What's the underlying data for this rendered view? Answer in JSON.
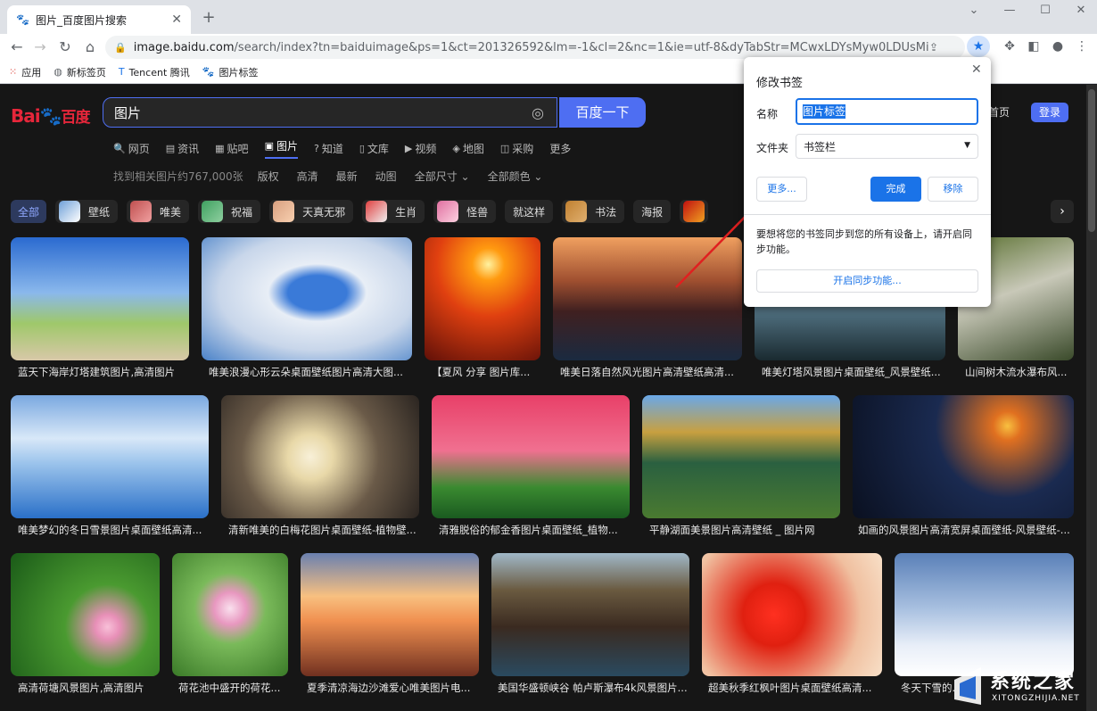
{
  "browser": {
    "tab_title": "图片_百度图片搜索",
    "url_host": "image.baidu.com",
    "url_path": "/search/index?tn=baiduimage&ps=1&ct=201326592&lm=-1&cl=2&nc=1&ie=utf-8&dyTabStr=MCwxLDYsMyw0LDUsMiw3LDgsOQ%3...",
    "bookmarks": [
      "应用",
      "新标签页",
      "Tencent 腾讯",
      "图片标签"
    ]
  },
  "page": {
    "logo_text": "Bai",
    "logo_cn": "百度",
    "search_query": "图片",
    "search_button": "百度一下",
    "nav": [
      "网页",
      "资讯",
      "贴吧",
      "图片",
      "知道",
      "文库",
      "视频",
      "地图",
      "采购",
      "更多"
    ],
    "filters": {
      "count": "找到相关图片约767,000张",
      "items": [
        "版权",
        "高清",
        "最新",
        "动图",
        "全部尺寸 ⌄",
        "全部颜色 ⌄"
      ]
    },
    "header_link": "首页",
    "login": "登录",
    "tags": [
      {
        "label": "全部"
      },
      {
        "label": "壁纸"
      },
      {
        "label": "唯美"
      },
      {
        "label": "祝福"
      },
      {
        "label": "天真无邪"
      },
      {
        "label": "生肖"
      },
      {
        "label": "怪兽"
      },
      {
        "label": "就这样"
      },
      {
        "label": "书法"
      },
      {
        "label": "海报"
      }
    ],
    "captions": [
      "蓝天下海岸灯塔建筑图片,高清图片",
      "唯美浪漫心形云朵桌面壁纸图片高清大图...",
      "【夏风 分享 图片库...",
      "唯美日落自然风光图片高清壁纸高清...",
      "唯美灯塔风景图片桌面壁纸_风景壁纸...",
      "山间树木流水瀑布风...",
      "唯美梦幻的冬日雪景图片桌面壁纸高清...",
      "清新唯美的白梅花图片桌面壁纸-植物壁...",
      "清雅脱俗的郁金香图片桌面壁纸_植物...",
      "平静湖面美景图片高清壁纸 _ 图片网",
      "如画的风景图片高清宽屏桌面壁纸-风景壁纸-...",
      "高清荷塘风景图片,高清图片",
      "荷花池中盛开的荷花...",
      "夏季清凉海边沙滩爱心唯美图片电...",
      "美国华盛顿峡谷 帕卢斯瀑布4k风景图片...",
      "超美秋季红枫叶图片桌面壁纸高清...",
      "冬天下雪的..."
    ]
  },
  "dialog": {
    "title": "修改书签",
    "name_label": "名称",
    "name_value": "图片标签",
    "folder_label": "文件夹",
    "folder_value": "书签栏",
    "more_button": "更多...",
    "done_button": "完成",
    "remove_button": "移除",
    "sync_text": "要想将您的书签同步到您的所有设备上，请开启同步功能。",
    "sync_button": "开启同步功能..."
  },
  "watermark": {
    "text": "系统之家",
    "url": "XITONGZHIJIA.NET"
  },
  "colors": {
    "accent": "#4e6ef2",
    "chrome_blue": "#1a73e8",
    "page_bg": "#161616"
  }
}
